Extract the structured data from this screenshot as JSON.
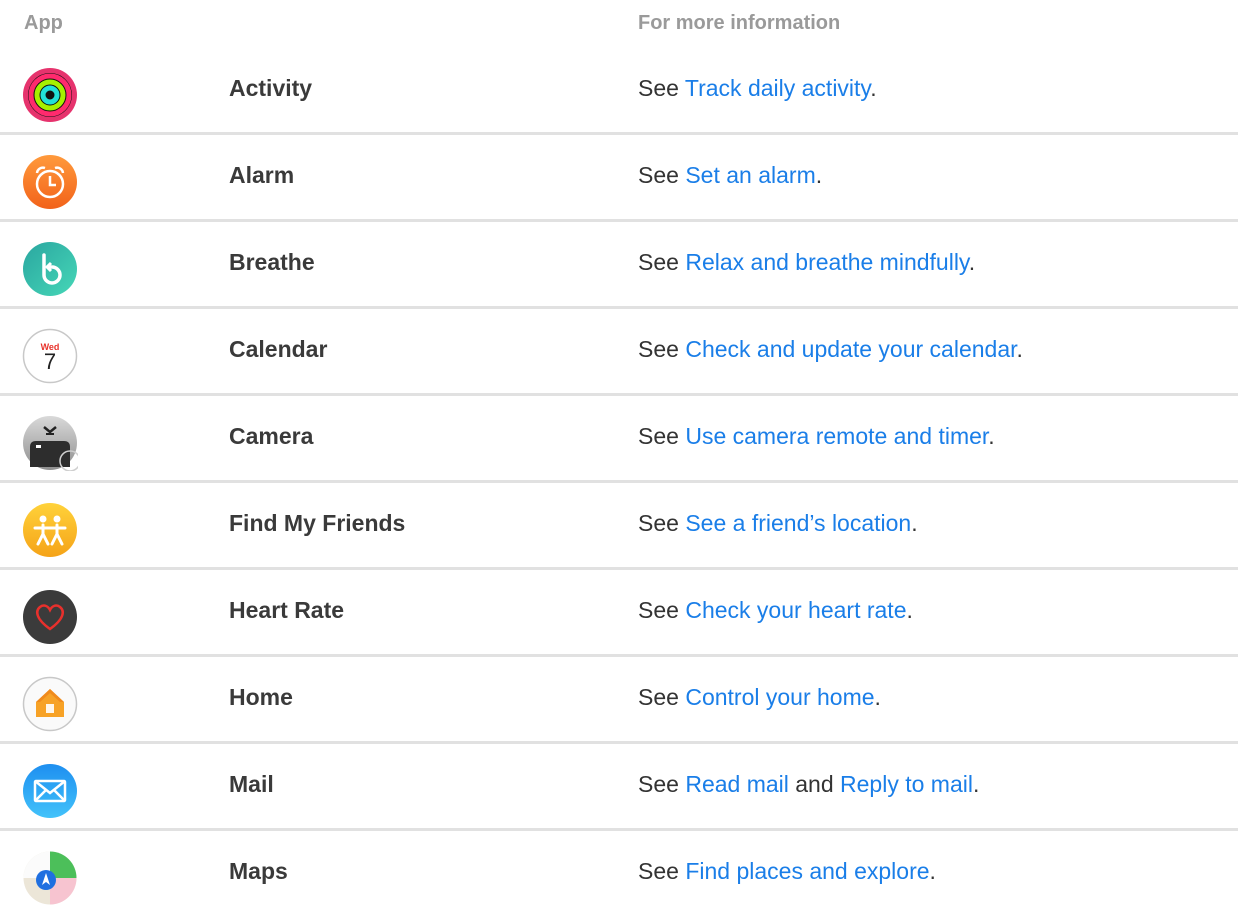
{
  "header": {
    "app": "App",
    "info": "For more information"
  },
  "rows": [
    {
      "app": "Activity",
      "see": "See ",
      "link1": "Track daily activity",
      "end": "."
    },
    {
      "app": "Alarm",
      "see": "See ",
      "link1": "Set an alarm",
      "end": "."
    },
    {
      "app": "Breathe",
      "see": "See ",
      "link1": "Relax and breathe mindfully",
      "end": "."
    },
    {
      "app": "Calendar",
      "see": "See ",
      "link1": "Check and update your calendar",
      "end": ".",
      "icon_day": "Wed",
      "icon_date": "7"
    },
    {
      "app": "Camera",
      "see": "See ",
      "link1": "Use camera remote and timer",
      "end": "."
    },
    {
      "app": "Find My Friends",
      "see": "See ",
      "link1": "See a friend’s location",
      "end": "."
    },
    {
      "app": "Heart Rate",
      "see": "See ",
      "link1": "Check your heart rate",
      "end": "."
    },
    {
      "app": "Home",
      "see": "See ",
      "link1": "Control your home",
      "end": "."
    },
    {
      "app": "Mail",
      "see": "See ",
      "link1": "Read mail",
      "mid": " and ",
      "link2": "Reply to mail",
      "end": "."
    },
    {
      "app": "Maps",
      "see": "See ",
      "link1": "Find places and explore",
      "end": "."
    }
  ],
  "icons": [
    "activity-icon",
    "alarm-icon",
    "breathe-icon",
    "calendar-icon",
    "camera-icon",
    "find-my-friends-icon",
    "heart-rate-icon",
    "home-icon",
    "mail-icon",
    "maps-icon"
  ],
  "colors": {
    "link": "#1a7ee8",
    "header_text": "#9a9a9a",
    "divider": "#e1e1e1"
  }
}
